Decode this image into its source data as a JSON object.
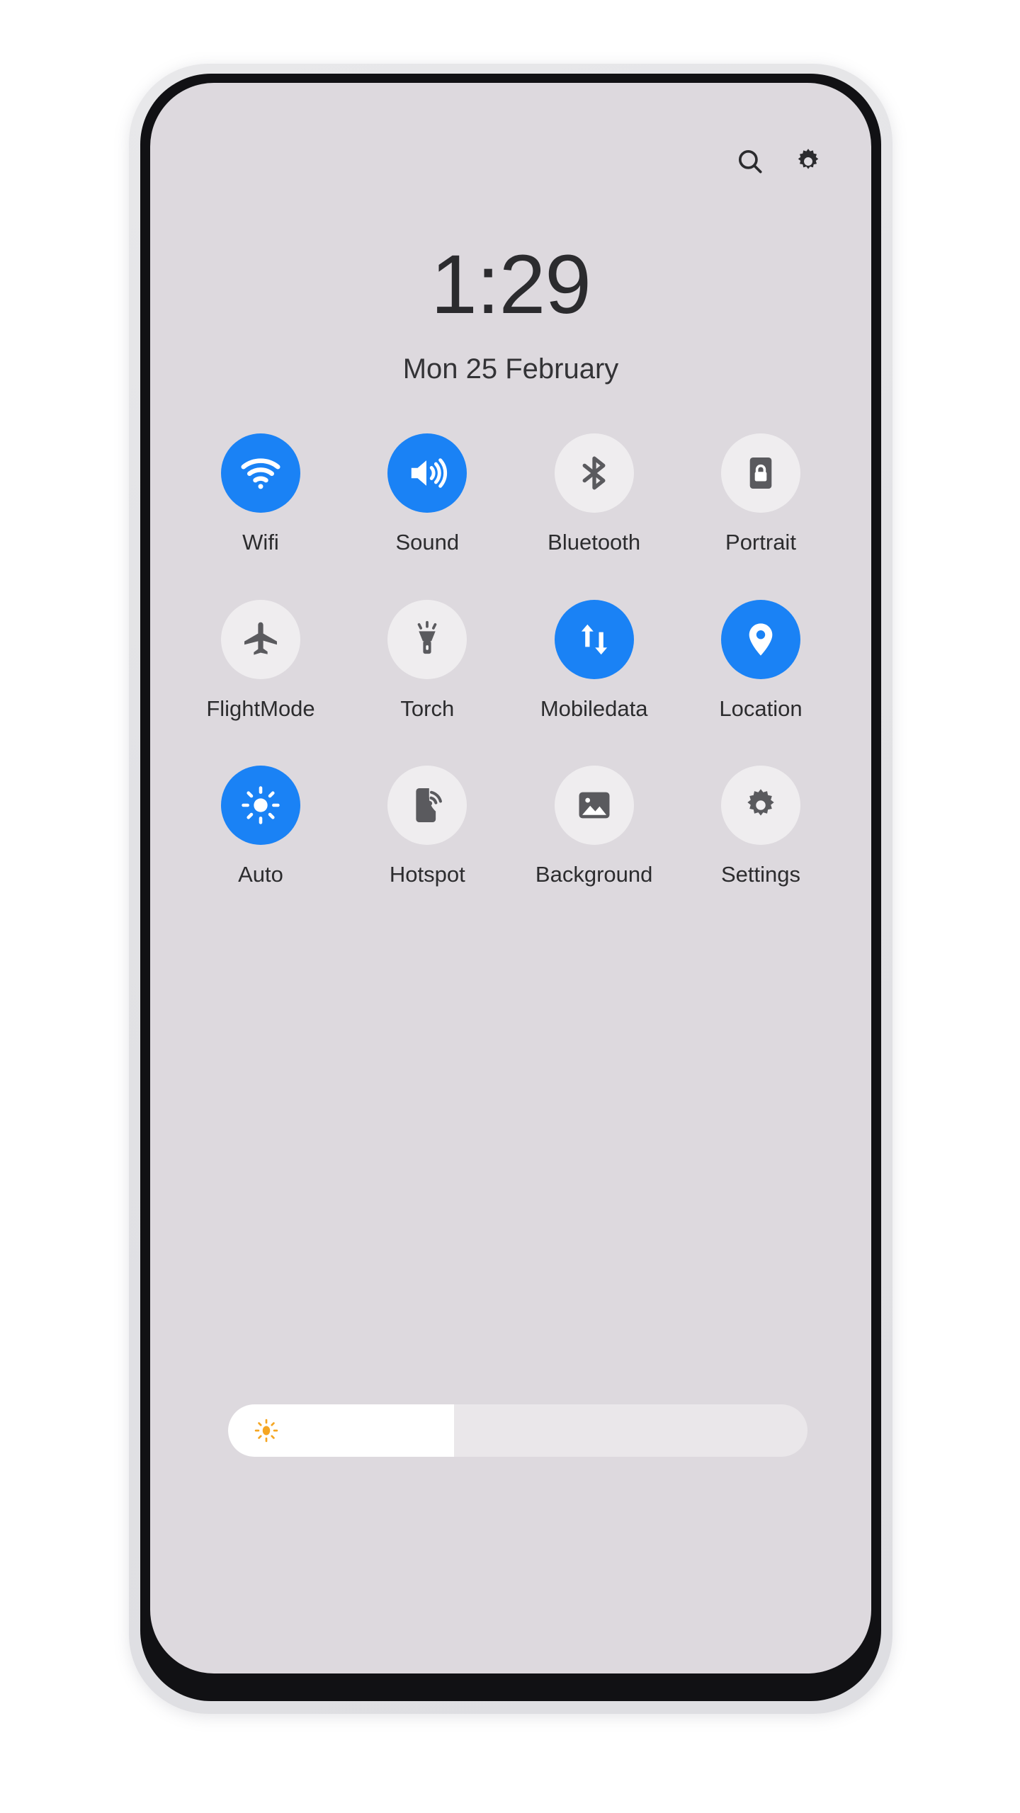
{
  "device": {
    "frame_color": "#e4e4e7",
    "bezel_color": "#111114"
  },
  "screen": {
    "accent_color": "#1a82f5",
    "label_color": "#2c2c2e",
    "inactive_tile_color": "rgba(255,255,255,0.52)",
    "inactive_icon_color": "#5a5a5e"
  },
  "top_bar": {
    "search_icon": "search-icon",
    "settings_icon": "gear-icon"
  },
  "clock": {
    "time": "1:29",
    "date": "Mon 25 February"
  },
  "tiles": {
    "rows": [
      [
        {
          "label": "Wifi",
          "icon": "wifi-icon",
          "state": "on"
        },
        {
          "label": "Sound",
          "icon": "volume-icon",
          "state": "on"
        },
        {
          "label": "Bluetooth",
          "icon": "bluetooth-icon",
          "state": "off"
        },
        {
          "label": "Portrait",
          "icon": "rotation-lock-icon",
          "state": "off"
        }
      ],
      [
        {
          "label": "FlightMode",
          "icon": "airplane-icon",
          "state": "off"
        },
        {
          "label": "Torch",
          "icon": "flashlight-icon",
          "state": "off"
        },
        {
          "label": "Mobiledata",
          "icon": "data-arrows-icon",
          "state": "on"
        },
        {
          "label": "Location",
          "icon": "map-pin-icon",
          "state": "on"
        }
      ],
      [
        {
          "label": "Auto",
          "icon": "brightness-sun-icon",
          "state": "on"
        },
        {
          "label": "Hotspot",
          "icon": "hotspot-icon",
          "state": "off"
        },
        {
          "label": "Background",
          "icon": "image-icon",
          "state": "off"
        },
        {
          "label": "Settings",
          "icon": "gear-icon",
          "state": "off"
        }
      ]
    ]
  },
  "brightness_slider": {
    "icon": "brightness-sun-icon",
    "icon_color": "#f5a623",
    "value_percent": 39,
    "fill_color": "#ffffff",
    "track_color": "rgba(255,255,255,0.38)"
  }
}
